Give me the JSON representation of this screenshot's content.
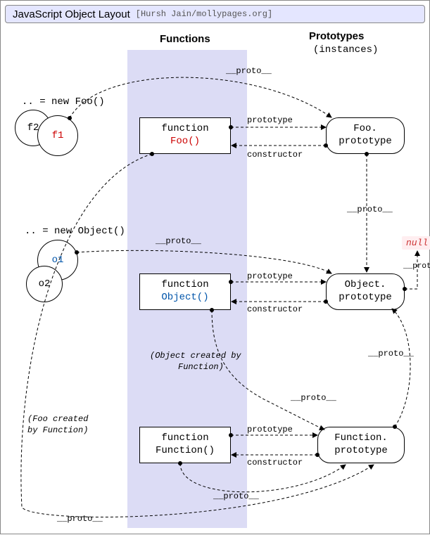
{
  "title": "JavaScript Object Layout",
  "credit": "[Hursh Jain/mollypages.org]",
  "columns": {
    "functions": "Functions",
    "prototypes": "Prototypes",
    "prototypes_sub": "(instances)"
  },
  "instances": {
    "foo_new": ".. = new Foo()",
    "f1": "f1",
    "f2": "f2",
    "obj_new": ".. = new Object()",
    "o1": "o1",
    "o2": "o2"
  },
  "functions": {
    "foo_kw": "function",
    "foo_name": "Foo()",
    "object_kw": "function",
    "object_name": "Object()",
    "function_kw": "function",
    "function_name": "Function()"
  },
  "prototypes": {
    "foo_l1": "Foo.",
    "foo_l2": "prototype",
    "object_l1": "Object.",
    "object_l2": "prototype",
    "function_l1": "Function.",
    "function_l2": "prototype"
  },
  "edges": {
    "proto": "__proto__",
    "prototype": "prototype",
    "constructor": "constructor"
  },
  "notes": {
    "obj_created": "(Object created by",
    "obj_created2": "Function)",
    "foo_created": "(Foo created",
    "foo_created2": "by Function)"
  },
  "null": "null"
}
